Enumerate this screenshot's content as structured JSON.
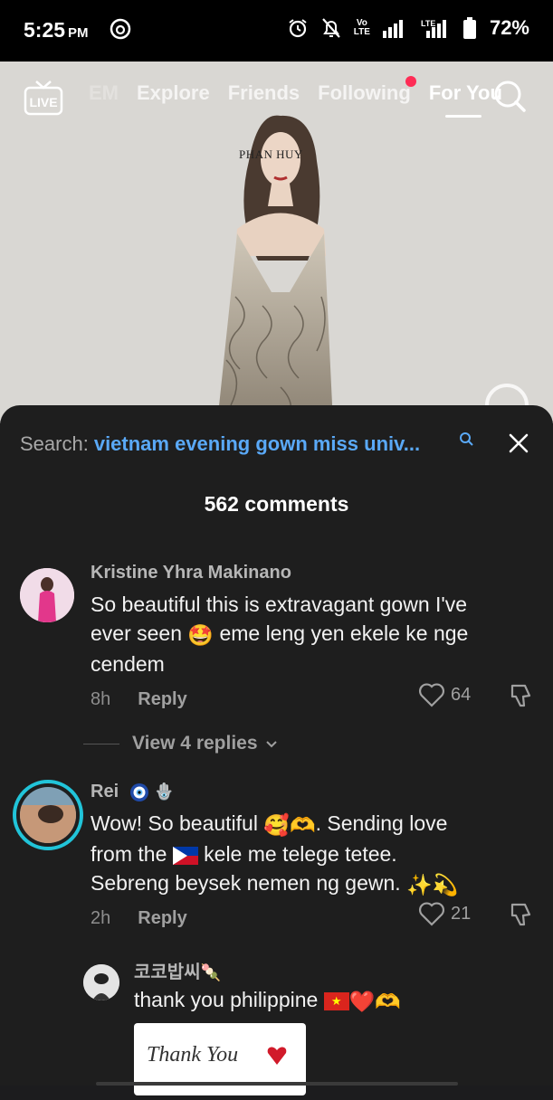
{
  "status_bar": {
    "time": "5:25",
    "ampm": "PM",
    "battery": "72%",
    "volte": "Vo LTE",
    "lte": "LTE"
  },
  "nav": {
    "tabs": [
      "EM",
      "Explore",
      "Friends",
      "Following",
      "For You"
    ],
    "live_label": "LIVE"
  },
  "video": {
    "brand_text": "PHAN HUY"
  },
  "search": {
    "label": "Search:",
    "query": "vietnam evening gown miss univ..."
  },
  "comments_count": "562 comments",
  "comments": [
    {
      "username": "Kristine Yhra Makinano",
      "text_line1": "So beautiful this is extravagant gown I've",
      "text_line2a": "ever seen",
      "text_line2b": "eme leng yen ekele ke nge",
      "text_line3": "cendem",
      "time": "8h",
      "reply": "Reply",
      "likes": "64",
      "view_replies": "View 4 replies"
    },
    {
      "username": "Rei",
      "text_line1a": "Wow! So beautiful",
      "text_line1b": ". Sending love",
      "text_line2a": "from the",
      "text_line2b": "kele me telege tetee.",
      "text_line3": "Sebreng beysek nemen ng gewn.",
      "time": "2h",
      "reply": "Reply",
      "likes": "21"
    }
  ],
  "reply": {
    "username": "코코밥씨",
    "text": "thank you philippine",
    "image_text": "Thank You"
  },
  "colors": {
    "accent_blue": "#5aa9f7",
    "notification_red": "#fe2c55",
    "sheet_bg": "#1e1e1e",
    "story_ring": "#21c4d9"
  }
}
